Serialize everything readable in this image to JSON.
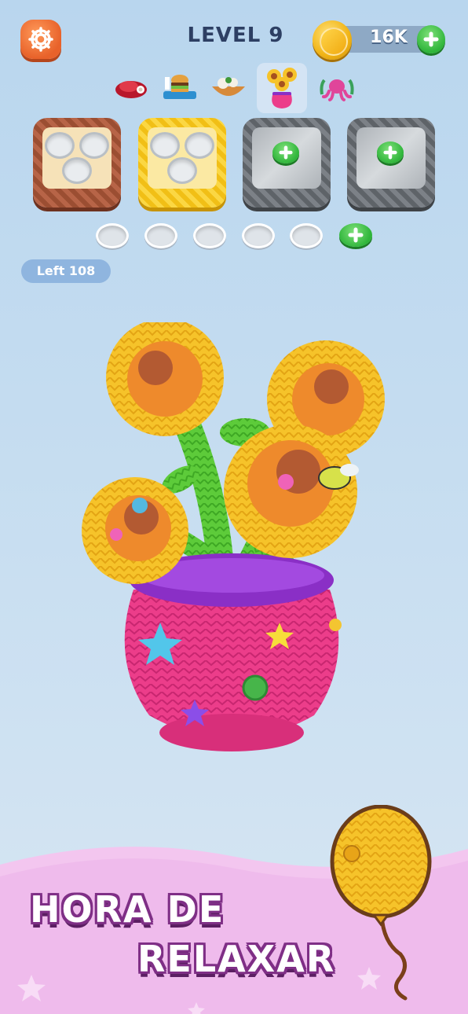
{
  "header": {
    "level_label": "LEVEL 9",
    "coins": "16K",
    "icons": {
      "settings": "gear-icon",
      "coin": "coin-icon",
      "add": "plus-icon"
    }
  },
  "categories": [
    {
      "name": "meat",
      "active": false
    },
    {
      "name": "burger-tray",
      "active": false
    },
    {
      "name": "food-bowl",
      "active": false
    },
    {
      "name": "sunflower-pot",
      "active": true
    },
    {
      "name": "octopus-plant",
      "active": false
    }
  ],
  "baskets": [
    {
      "color": "#a7583a",
      "state": "open",
      "holes": 3
    },
    {
      "color": "#f4c81f",
      "state": "open",
      "holes": 3
    },
    {
      "color": "#6f747a",
      "state": "locked"
    },
    {
      "color": "#6f747a",
      "state": "locked"
    }
  ],
  "queue_slots": {
    "empty": 5,
    "add_slot": true
  },
  "left_counter": "Left 108",
  "banner": {
    "line1": "HORA DE",
    "line2": "RELAXAR"
  },
  "colors": {
    "background": "#c4dcf0",
    "yarn_yellow": "#f5c12a",
    "pot_pink": "#ec3d8a",
    "pot_rim": "#8a2fc6",
    "leaf_green": "#5dcb3a",
    "banner_pink": "#f3c6ef"
  }
}
